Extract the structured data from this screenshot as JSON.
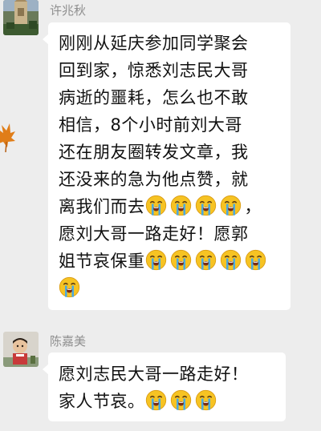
{
  "messages": [
    {
      "sender": "许兆秋",
      "lines": [
        "刚刚从延庆参加同学聚会",
        "回到家，惊悉刘志民大哥",
        "病逝的噩耗，怎么也不敢",
        "相信，8个小时前刘大哥",
        "还在朋友圈转发文章，我",
        "还没来的急为他点赞，就",
        "离我们而去",
        "愿刘大哥一路走好！愿郭",
        "姐节哀保重"
      ],
      "line_7_suffix": "，"
    },
    {
      "sender": "陈嘉美",
      "lines": [
        "愿刘志民大哥一路走好！",
        "家人节哀。"
      ]
    }
  ],
  "icons": {
    "crying_emoji": "loudly-crying-face-icon",
    "leaf": "maple-leaf-icon"
  },
  "colors": {
    "background": "#ededed",
    "bubble": "#ffffff",
    "sender_name": "#8f8f8f",
    "text": "#111111",
    "emoji_face": "#f6c323",
    "tears": "#4aa8e0",
    "leaf": "#e07d18"
  }
}
